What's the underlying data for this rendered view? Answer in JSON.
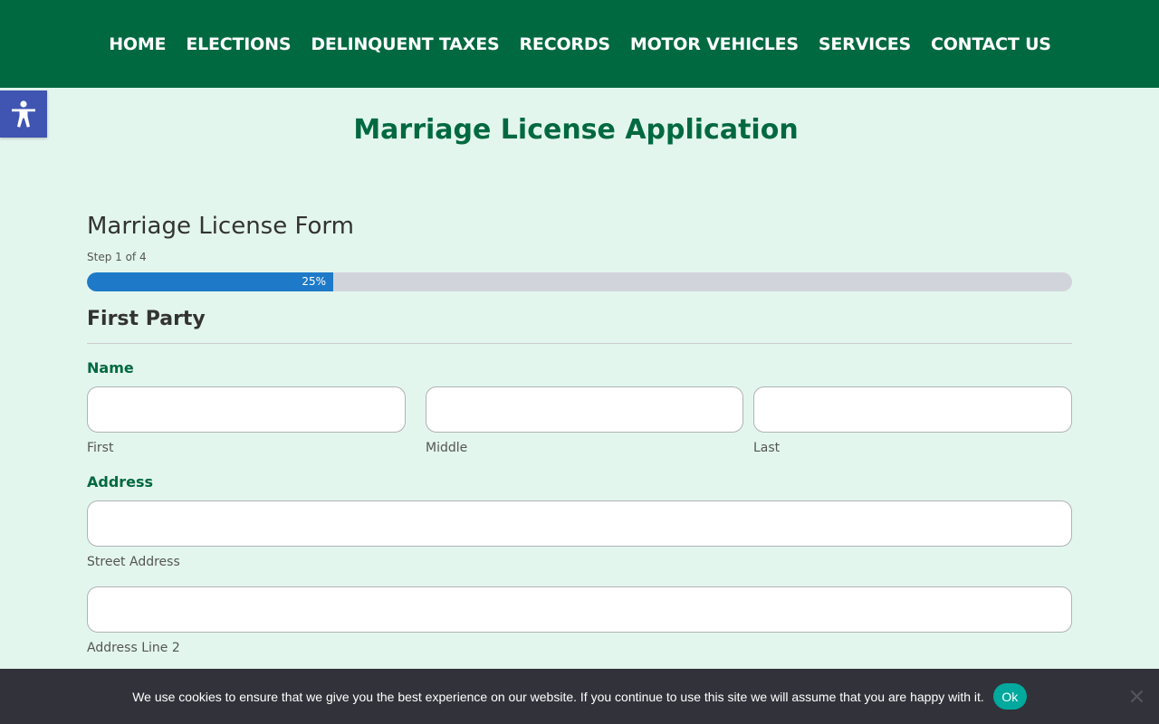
{
  "nav": {
    "items": [
      {
        "label": "HOME"
      },
      {
        "label": "ELECTIONS"
      },
      {
        "label": "DELINQUENT TAXES"
      },
      {
        "label": "RECORDS"
      },
      {
        "label": "MOTOR VEHICLES"
      },
      {
        "label": "SERVICES"
      },
      {
        "label": "CONTACT US"
      }
    ],
    "background": "#016940"
  },
  "accessibility": {
    "icon": "accessibility-icon",
    "color": "#4054b2"
  },
  "page": {
    "title": "Marriage License Application"
  },
  "form": {
    "title": "Marriage License Form",
    "step_text": "Step 1 of 4",
    "progress": {
      "percent": 25,
      "label": "25%",
      "fill_color": "#1e7ac8"
    },
    "section_title": "First Party",
    "name": {
      "label": "Name",
      "first_sub": "First",
      "middle_sub": "Middle",
      "last_sub": "Last",
      "first_value": "",
      "middle_value": "",
      "last_value": ""
    },
    "address": {
      "label": "Address",
      "street_sub": "Street Address",
      "line2_sub": "Address Line 2",
      "street_value": "",
      "line2_value": ""
    }
  },
  "cookie": {
    "text": "We use cookies to ensure that we give you the best experience on our website. If you continue to use this site we will assume that you are happy with it.",
    "ok_label": "Ok",
    "close_icon": "close-icon"
  }
}
